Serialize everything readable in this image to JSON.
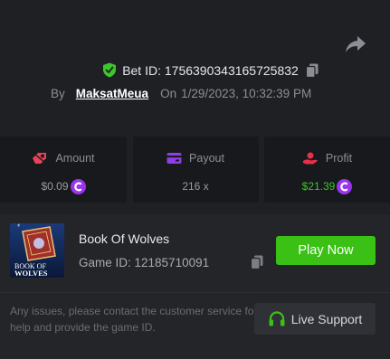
{
  "header": {
    "bet_id": "Bet ID: 1756390343165725832",
    "by_label": "By",
    "username": "MaksatMeua",
    "on_label": "On",
    "datetime": "1/29/2023, 10:32:39 PM"
  },
  "stats": {
    "amount": {
      "label": "Amount",
      "value": "$0.09"
    },
    "payout": {
      "label": "Payout",
      "value": "216 x"
    },
    "profit": {
      "label": "Profit",
      "value": "$21.39"
    }
  },
  "game": {
    "thumb_title_1": "BOOK OF",
    "thumb_title_2": "WOLVES",
    "name": "Book Of Wolves",
    "game_id": "Game ID: 12185710091",
    "play_label": "Play Now"
  },
  "footer": {
    "note": "Any issues, please contact the customer service for help and provide the game ID.",
    "support_label": "Live Support"
  },
  "colors": {
    "background": "#1f2024",
    "card": "#18191c",
    "accent_green": "#3bc116",
    "profit_green": "#3cc628",
    "coin_purple": "#9b34ef",
    "amount_icon": "#e8425a",
    "payout_icon": "#8e3fe6",
    "profit_icon": "#e8304a",
    "verified_shield": "#3cc628"
  },
  "icons": {
    "share": "share-icon",
    "shield": "verified-shield-icon",
    "copy": "copy-icon",
    "amount": "bet-chip-icon",
    "payout": "wallet-icon",
    "profit": "profit-hand-icon",
    "coin": "coin-icon",
    "support": "headset-icon"
  }
}
